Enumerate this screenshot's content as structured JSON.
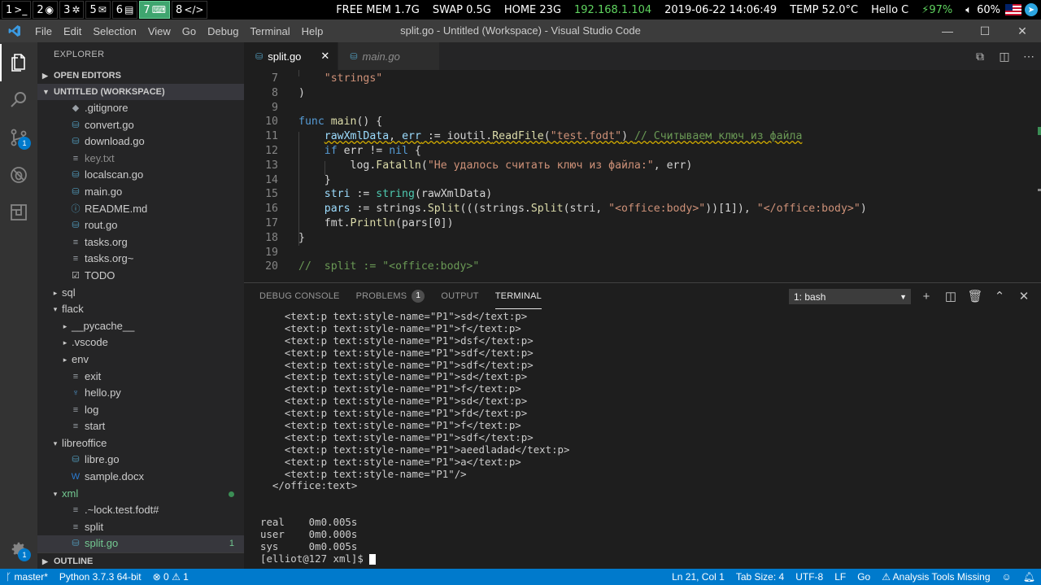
{
  "system_bar": {
    "workspaces": [
      {
        "num": "1",
        "icon": "terminal-icon",
        "glyph": ">_",
        "active": false
      },
      {
        "num": "2",
        "icon": "chrome-icon",
        "glyph": "◉",
        "active": false
      },
      {
        "num": "3",
        "icon": "settings-icon",
        "glyph": "✲",
        "active": false
      },
      {
        "num": "5",
        "icon": "mail-icon",
        "glyph": "✉",
        "active": false
      },
      {
        "num": "6",
        "icon": "document-icon",
        "glyph": "▤",
        "active": false
      },
      {
        "num": "7",
        "icon": "keyboard-icon",
        "glyph": "⌨",
        "active": true
      },
      {
        "num": "8",
        "icon": "code-icon",
        "glyph": "</>",
        "active": false
      }
    ],
    "free_mem": "FREE MEM 1.7G",
    "swap": "SWAP 0.5G",
    "home": "HOME 23G",
    "ip": "192.168.1.104",
    "datetime": "2019-06-22 14:06:49",
    "temp": "TEMP 52.0°C",
    "greeting": "Hello C",
    "battery": "⚡97%",
    "volume": "60%"
  },
  "window": {
    "title": "split.go - Untitled (Workspace) - Visual Studio Code",
    "menu": [
      "File",
      "Edit",
      "Selection",
      "View",
      "Go",
      "Debug",
      "Terminal",
      "Help"
    ]
  },
  "activity_bar": {
    "scm_badge": "1",
    "settings_badge": "1"
  },
  "sidebar": {
    "title": "EXPLORER",
    "open_editors": "OPEN EDITORS",
    "workspace": "UNTITLED (WORKSPACE)",
    "outline": "OUTLINE",
    "tree": [
      {
        "name": ".gitignore",
        "icon": "git-icon",
        "glyph": "◆",
        "cls": "txt-ico",
        "indent": 1,
        "twisty": ""
      },
      {
        "name": "convert.go",
        "icon": "go-file-icon",
        "glyph": "⛁",
        "cls": "go-ico",
        "indent": 1,
        "twisty": ""
      },
      {
        "name": "download.go",
        "icon": "go-file-icon",
        "glyph": "⛁",
        "cls": "go-ico",
        "indent": 1,
        "twisty": ""
      },
      {
        "name": "key.txt",
        "icon": "text-file-icon",
        "glyph": "≡",
        "cls": "txt-ico",
        "indent": 1,
        "twisty": "",
        "dim": true
      },
      {
        "name": "localscan.go",
        "icon": "go-file-icon",
        "glyph": "⛁",
        "cls": "go-ico",
        "indent": 1,
        "twisty": ""
      },
      {
        "name": "main.go",
        "icon": "go-file-icon",
        "glyph": "⛁",
        "cls": "go-ico",
        "indent": 1,
        "twisty": ""
      },
      {
        "name": "README.md",
        "icon": "info-icon",
        "glyph": "ⓘ",
        "cls": "md-ico",
        "indent": 1,
        "twisty": ""
      },
      {
        "name": "rout.go",
        "icon": "go-file-icon",
        "glyph": "⛁",
        "cls": "go-ico",
        "indent": 1,
        "twisty": ""
      },
      {
        "name": "tasks.org",
        "icon": "text-file-icon",
        "glyph": "≡",
        "cls": "txt-ico",
        "indent": 1,
        "twisty": ""
      },
      {
        "name": "tasks.org~",
        "icon": "text-file-icon",
        "glyph": "≡",
        "cls": "txt-ico",
        "indent": 1,
        "twisty": ""
      },
      {
        "name": "TODO",
        "icon": "checkbox-icon",
        "glyph": "☑",
        "cls": "todo-ico",
        "indent": 1,
        "twisty": ""
      },
      {
        "name": "sql",
        "icon": "",
        "glyph": "",
        "cls": "",
        "indent": 0,
        "twisty": "›"
      },
      {
        "name": "flack",
        "icon": "",
        "glyph": "",
        "cls": "",
        "indent": 0,
        "twisty": "⌄"
      },
      {
        "name": "__pycache__",
        "icon": "",
        "glyph": "",
        "cls": "",
        "indent": 1,
        "twisty": "›"
      },
      {
        "name": ".vscode",
        "icon": "",
        "glyph": "",
        "cls": "",
        "indent": 1,
        "twisty": "›"
      },
      {
        "name": "env",
        "icon": "",
        "glyph": "",
        "cls": "",
        "indent": 1,
        "twisty": "›"
      },
      {
        "name": "exit",
        "icon": "text-file-icon",
        "glyph": "≡",
        "cls": "txt-ico",
        "indent": 1,
        "twisty": ""
      },
      {
        "name": "hello.py",
        "icon": "python-file-icon",
        "glyph": "♆",
        "cls": "py-ico",
        "indent": 1,
        "twisty": ""
      },
      {
        "name": "log",
        "icon": "text-file-icon",
        "glyph": "≡",
        "cls": "txt-ico",
        "indent": 1,
        "twisty": ""
      },
      {
        "name": "start",
        "icon": "text-file-icon",
        "glyph": "≡",
        "cls": "txt-ico",
        "indent": 1,
        "twisty": ""
      },
      {
        "name": "libreoffice",
        "icon": "",
        "glyph": "",
        "cls": "",
        "indent": 0,
        "twisty": "⌄"
      },
      {
        "name": "libre.go",
        "icon": "go-file-icon",
        "glyph": "⛁",
        "cls": "go-ico",
        "indent": 1,
        "twisty": ""
      },
      {
        "name": "sample.docx",
        "icon": "word-file-icon",
        "glyph": "W",
        "cls": "doc-ico",
        "indent": 1,
        "twisty": ""
      },
      {
        "name": "xml",
        "icon": "",
        "glyph": "",
        "cls": "",
        "indent": 0,
        "twisty": "⌄",
        "green": true,
        "dot": true
      },
      {
        "name": ".~lock.test.fodt#",
        "icon": "text-file-icon",
        "glyph": "≡",
        "cls": "txt-ico",
        "indent": 1,
        "twisty": ""
      },
      {
        "name": "split",
        "icon": "text-file-icon",
        "glyph": "≡",
        "cls": "txt-ico",
        "indent": 1,
        "twisty": ""
      },
      {
        "name": "split.go",
        "icon": "go-file-icon",
        "glyph": "⛁",
        "cls": "go-ico",
        "indent": 1,
        "twisty": "",
        "green": true,
        "selected": true,
        "badge": "1"
      }
    ]
  },
  "tabs": [
    {
      "label": "split.go",
      "active": true,
      "close": "✕"
    },
    {
      "label": "main.go",
      "active": false,
      "close": ""
    }
  ],
  "editor": {
    "lines": [
      {
        "n": "7",
        "html": "    <span class=\"s\">\"strings\"</span>"
      },
      {
        "n": "8",
        "html": "<span class=\"p\">)</span>"
      },
      {
        "n": "9",
        "html": ""
      },
      {
        "n": "10",
        "html": "<span class=\"k\">func</span> <span class=\"f\">main</span><span class=\"p\">() {</span>"
      },
      {
        "n": "11",
        "html": "    <span class=\"squig\"><span class=\"v\">rawXmlData</span><span class=\"p\">, </span><span class=\"v\">err</span><span class=\"p\"> := ioutil.</span><span class=\"f\">ReadFile</span><span class=\"p\">(</span><span class=\"s\">\"test.fodt\"</span><span class=\"p\">) </span><span class=\"c\">// Считываем ключ из файла</span></span>"
      },
      {
        "n": "12",
        "html": "    <span class=\"k\">if</span><span class=\"p\"> err != </span><span class=\"k\">nil</span><span class=\"p\"> {</span>"
      },
      {
        "n": "13",
        "html": "        <span class=\"p\">log.</span><span class=\"f\">Fatalln</span><span class=\"p\">(</span><span class=\"s\">\"Не удалось считать ключ из файла:\"</span><span class=\"p\">, err)</span>"
      },
      {
        "n": "14",
        "html": "    <span class=\"p\">}</span>"
      },
      {
        "n": "15",
        "html": "    <span class=\"v\">stri</span><span class=\"p\"> := </span><span class=\"t\">string</span><span class=\"p\">(rawXmlData)</span>"
      },
      {
        "n": "16",
        "html": "    <span class=\"v\">pars</span><span class=\"p\"> := strings.</span><span class=\"f\">Split</span><span class=\"p\">(((strings.</span><span class=\"f\">Split</span><span class=\"p\">(stri, </span><span class=\"s\">\"&lt;office:body&gt;\"</span><span class=\"p\">))[1]), </span><span class=\"s\">\"&lt;/office:body&gt;\"</span><span class=\"p\">)</span>"
      },
      {
        "n": "17",
        "html": "    <span class=\"p\">fmt.</span><span class=\"f\">Println</span><span class=\"p\">(pars[0])</span>"
      },
      {
        "n": "18",
        "html": "<span class=\"p\">}</span>"
      },
      {
        "n": "19",
        "html": ""
      },
      {
        "n": "20",
        "html": "<span class=\"c\">//  split := \"&lt;office:body&gt;\"</span>"
      }
    ]
  },
  "panel": {
    "tabs": [
      {
        "label": "DEBUG CONSOLE",
        "active": false,
        "badge": ""
      },
      {
        "label": "PROBLEMS",
        "active": false,
        "badge": "1"
      },
      {
        "label": "OUTPUT",
        "active": false,
        "badge": ""
      },
      {
        "label": "TERMINAL",
        "active": true,
        "badge": ""
      }
    ],
    "terminal_select": "1: bash",
    "terminal_lines": [
      "    <text:p text:style-name=\"P1\">sd</text:p>",
      "    <text:p text:style-name=\"P1\">f</text:p>",
      "    <text:p text:style-name=\"P1\">dsf</text:p>",
      "    <text:p text:style-name=\"P1\">sdf</text:p>",
      "    <text:p text:style-name=\"P1\">sdf</text:p>",
      "    <text:p text:style-name=\"P1\">sd</text:p>",
      "    <text:p text:style-name=\"P1\">f</text:p>",
      "    <text:p text:style-name=\"P1\">sd</text:p>",
      "    <text:p text:style-name=\"P1\">fd</text:p>",
      "    <text:p text:style-name=\"P1\">f</text:p>",
      "    <text:p text:style-name=\"P1\">sdf</text:p>",
      "    <text:p text:style-name=\"P1\">aeedladad</text:p>",
      "    <text:p text:style-name=\"P1\">a</text:p>",
      "    <text:p text:style-name=\"P1\"/>",
      "  </office:text>",
      "",
      "",
      "real    0m0.005s",
      "user    0m0.000s",
      "sys     0m0.005s"
    ],
    "prompt": "[elliot@127 xml]$ "
  },
  "status_bar": {
    "branch": "master*",
    "python": "Python 3.7.3 64-bit",
    "errors": "0",
    "warnings": "1",
    "position": "Ln 21, Col 1",
    "tab_size": "Tab Size: 4",
    "encoding": "UTF-8",
    "eol": "LF",
    "language": "Go",
    "analysis": "Analysis Tools Missing"
  }
}
